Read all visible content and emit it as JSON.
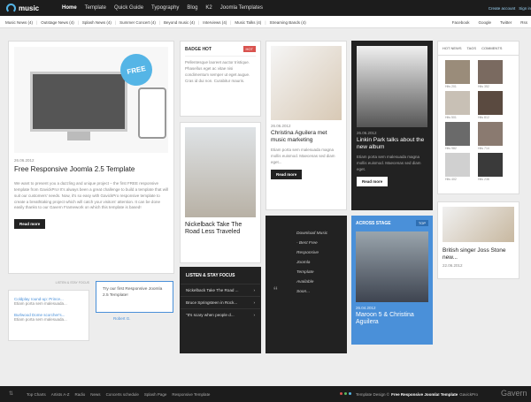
{
  "brand": {
    "name": "music"
  },
  "nav": [
    "Home",
    "Template",
    "Quick Guide",
    "Typography",
    "Blog",
    "K2",
    "Joomla Templates"
  ],
  "account": {
    "create": "Create account",
    "signin": "Sign in"
  },
  "subnav": [
    "Music News (4)",
    "Outstage News (4)",
    "Splash News (4)",
    "Summer Concert (4)",
    "Beyond music (4)",
    "Interviews (4)",
    "Music Talks (4)",
    "Streaming Bands (4)"
  ],
  "social": [
    "Facebook",
    "Google",
    "Twitter",
    "Rss"
  ],
  "featured": {
    "free_badge": "FREE",
    "date": "26.06.2012",
    "title": "Free Responsive Joomla 2.5 Template",
    "body": "We want to present you a dazzling and unique project – the first FREE responsive template from GavickPro! It's always been a great challenge to build a template that will suit our customers' needs. Now, it's so easy with GavickPro responsive template to create a breathtaking project which will catch your visitors' attention. It can be done easily thanks to our Gavern Framework on which this template is based!",
    "button": "Read more"
  },
  "badge": {
    "label": "BADGE HOT",
    "tag": "HOT",
    "text": "Pellentesque laoreet auctor tristique. Phasellus eget ac vitae nisi condimentum semper ut eget augue. Cras id dui non. Curabitur mauris."
  },
  "nickelback": {
    "title": "Nickelback Take The Road Less Traveled"
  },
  "listen": {
    "heading": "LISTEN & STAY FOCUS",
    "items": [
      "Nickelback Take The Road ...",
      "Bruce Springsteen in Rock...",
      "\"It's scary when people d..."
    ]
  },
  "christina": {
    "date": "26.06.2012",
    "title": "Christina Aguilera met music marketing",
    "text": "Etiam porta sem malesuada magna mollis euismod. Maecenas sed diam eget...",
    "button": "Read more"
  },
  "quote": {
    "lines": [
      "Download Music",
      "- Best Free",
      "Responsive",
      "Joomla",
      "Template",
      "Available",
      "Soon..."
    ]
  },
  "linkin": {
    "date": "26.06.2012",
    "title": "Linkin Park talks about the new album",
    "text": "Etiam porta sem malesuada magna mollis euismod. Maecenas sed diam eget.",
    "button": "Read more"
  },
  "across": {
    "heading": "ACROSS STAGE",
    "tag": "TOP",
    "date": "26.04.2012",
    "title": "Maroon 5 & Christina Aguilera"
  },
  "sidebar": {
    "tabs": [
      "HOT NEWS",
      "TAGS",
      "COMMENTS"
    ],
    "captions": [
      "Hits 201",
      "Hits 352",
      "Hits 501",
      "Hits 812",
      "Hits 982",
      "Hits 714",
      "Hits 402",
      "Hits 238"
    ]
  },
  "joss": {
    "title": "British singer Joss Stone new...",
    "date": "22.06.2012"
  },
  "bottom_left": {
    "heading": "LISTEN & STAY FOCUS",
    "items": [
      {
        "title": "Coldplay round-up: Prince...",
        "text": "Etiam porta sem malesuada..."
      },
      {
        "title": "Burlwood Dome scorcher's...",
        "text": "Etiam porta sem malesuada..."
      }
    ]
  },
  "tooltip": {
    "text": "Try our first Responsive Joomla 2.5 Template!",
    "author": "Robert G."
  },
  "footer": {
    "links": [
      "Top Charts",
      "Artists A-Z",
      "Radio",
      "News",
      "Concerts schedule",
      "Splash Page",
      "Responsive Template"
    ],
    "credit_prefix": "Template Design ©",
    "credit_bold": "Free Responsive Joomla! Template",
    "credit_suffix": "GavickPro",
    "logo": "Gavern"
  },
  "colors": {
    "accent": "#55b5e6",
    "hot": "#d9534f",
    "blue_card": "#4a90d9"
  }
}
